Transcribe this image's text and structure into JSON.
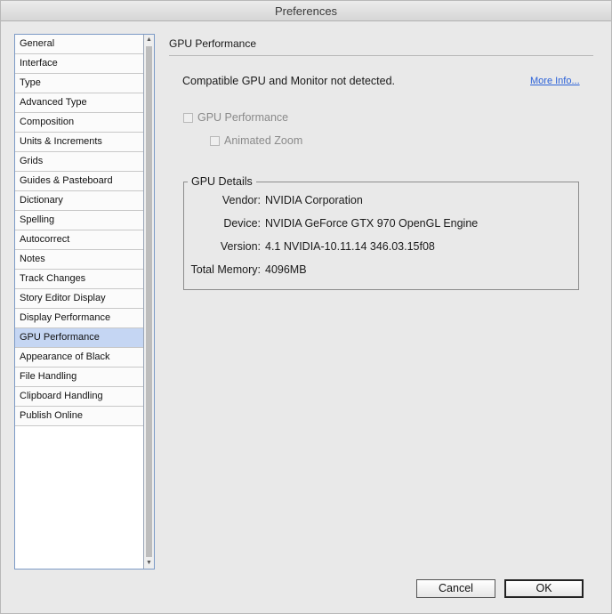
{
  "window": {
    "title": "Preferences"
  },
  "sidebar": {
    "items": [
      {
        "label": "General"
      },
      {
        "label": "Interface"
      },
      {
        "label": "Type"
      },
      {
        "label": "Advanced Type"
      },
      {
        "label": "Composition"
      },
      {
        "label": "Units & Increments"
      },
      {
        "label": "Grids"
      },
      {
        "label": "Guides & Pasteboard"
      },
      {
        "label": "Dictionary"
      },
      {
        "label": "Spelling"
      },
      {
        "label": "Autocorrect"
      },
      {
        "label": "Notes"
      },
      {
        "label": "Track Changes"
      },
      {
        "label": "Story Editor Display"
      },
      {
        "label": "Display Performance"
      },
      {
        "label": "GPU Performance",
        "selected": true
      },
      {
        "label": "Appearance of Black"
      },
      {
        "label": "File Handling"
      },
      {
        "label": "Clipboard Handling"
      },
      {
        "label": "Publish Online"
      }
    ],
    "scroll_up_icon": "arrow-up-icon",
    "scroll_down_icon": "arrow-down-icon"
  },
  "main": {
    "title": "GPU Performance",
    "notice": "Compatible GPU and Monitor not detected.",
    "more_info_link": "More Info...",
    "gpu_performance_checkbox": {
      "label": "GPU Performance",
      "checked": false,
      "enabled": false
    },
    "animated_zoom_checkbox": {
      "label": "Animated Zoom",
      "checked": false,
      "enabled": false
    },
    "details": {
      "legend": "GPU Details",
      "rows": [
        {
          "label": "Vendor:",
          "value": "NVIDIA Corporation"
        },
        {
          "label": "Device:",
          "value": "NVIDIA GeForce GTX 970 OpenGL Engine"
        },
        {
          "label": "Version:",
          "value": "4.1 NVIDIA-10.11.14 346.03.15f08"
        },
        {
          "label": "Total Memory:",
          "value": "4096MB"
        }
      ]
    }
  },
  "buttons": {
    "cancel": "Cancel",
    "ok": "OK"
  },
  "colors": {
    "selected_item": "#c5d6f3",
    "link": "#2c62d8"
  }
}
